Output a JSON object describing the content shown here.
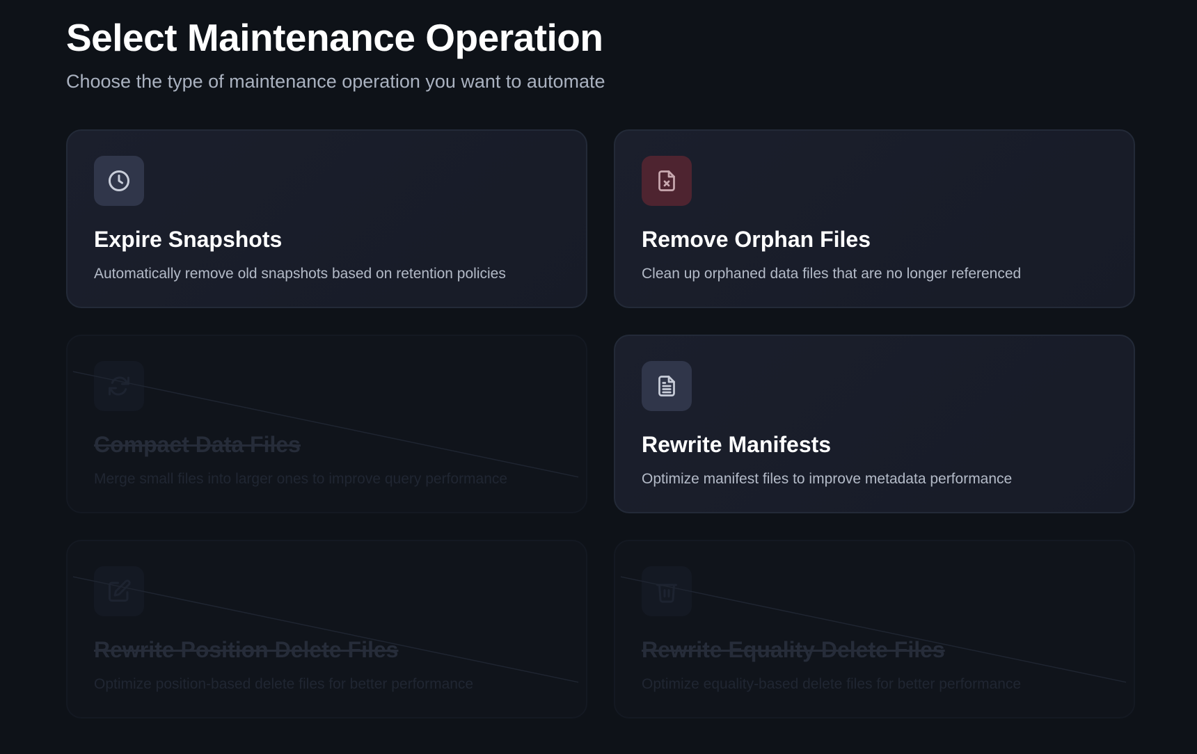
{
  "header": {
    "title": "Select Maintenance Operation",
    "subtitle": "Choose the type of maintenance operation you want to automate"
  },
  "operations": [
    {
      "title": "Expire Snapshots",
      "description": "Automatically remove old snapshots based on retention policies",
      "icon": "clock-icon",
      "enabled": true,
      "icon_color": "#c9ceda"
    },
    {
      "title": "Remove Orphan Files",
      "description": "Clean up orphaned data files that are no longer referenced",
      "icon": "file-x-icon",
      "enabled": true,
      "icon_color": "#c9a9b0"
    },
    {
      "title": "Compact Data Files",
      "description": "Merge small files into larger ones to improve query performance",
      "icon": "refresh-icon",
      "enabled": false
    },
    {
      "title": "Rewrite Manifests",
      "description": "Optimize manifest files to improve metadata performance",
      "icon": "file-text-icon",
      "enabled": true,
      "icon_color": "#c9ceda"
    },
    {
      "title": "Rewrite Position Delete Files",
      "description": "Optimize position-based delete files for better performance",
      "icon": "edit-icon",
      "enabled": false
    },
    {
      "title": "Rewrite Equality Delete Files",
      "description": "Optimize equality-based delete files for better performance",
      "icon": "trash-icon",
      "enabled": false
    }
  ]
}
